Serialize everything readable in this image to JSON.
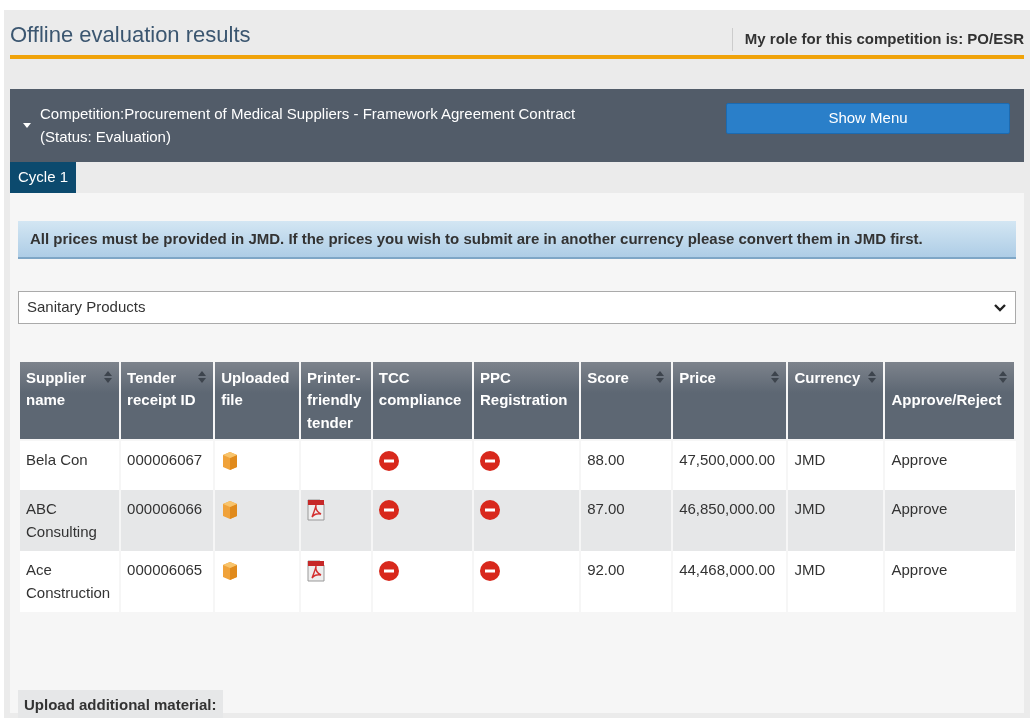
{
  "page": {
    "title": "Offline evaluation results",
    "role": "My role for this competition is: PO/ESR"
  },
  "competition": {
    "label": "Competition:",
    "name": "Procurement of Medical Suppliers - Framework Agreement Contract",
    "status": "(Status: Evaluation)",
    "expanded": true,
    "menu_button": "Show Menu"
  },
  "tabs": [
    {
      "label": "Cycle 1",
      "selected": true
    }
  ],
  "notice": "All prices must be provided in JMD. If the prices you wish to submit are in another currency please convert them in JMD first.",
  "lot_select": {
    "value": "Sanitary Products"
  },
  "table": {
    "columns": [
      {
        "label": "Supplier name",
        "sortable": true
      },
      {
        "label": "Tender receipt ID",
        "sortable": true
      },
      {
        "label": "Uploaded file",
        "sortable": false
      },
      {
        "label": "Printer-friendly tender",
        "sortable": false
      },
      {
        "label": "TCC compliance",
        "sortable": false
      },
      {
        "label": "PPC Registration",
        "sortable": false
      },
      {
        "label": "Score",
        "sortable": true
      },
      {
        "label": "Price",
        "sortable": true
      },
      {
        "label": "Currency",
        "sortable": true
      },
      {
        "label": "Approve/Reject",
        "sortable": true
      }
    ],
    "rows": [
      {
        "supplier": "Bela Con",
        "tender_id": "000006067",
        "uploaded_file": true,
        "printer_friendly": false,
        "tcc_compliant": false,
        "ppc_registered": false,
        "score": "88.00",
        "price": "47,500,000.00",
        "currency": "JMD",
        "decision": "Approve"
      },
      {
        "supplier": "ABC Consulting",
        "tender_id": "000006066",
        "uploaded_file": true,
        "printer_friendly": true,
        "tcc_compliant": false,
        "ppc_registered": false,
        "score": "87.00",
        "price": "46,850,000.00",
        "currency": "JMD",
        "decision": "Approve"
      },
      {
        "supplier": "Ace Construction",
        "tender_id": "000006065",
        "uploaded_file": true,
        "printer_friendly": true,
        "tcc_compliant": false,
        "ppc_registered": false,
        "score": "92.00",
        "price": "44,468,000.00",
        "currency": "JMD",
        "decision": "Approve"
      }
    ]
  },
  "upload_label": "Upload additional material:"
}
